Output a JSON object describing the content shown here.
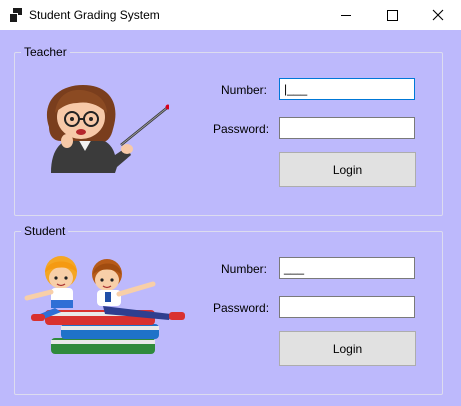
{
  "window": {
    "title": "Student Grading System",
    "icons": {
      "app": "app-icon",
      "minimize": "minimize-icon",
      "maximize": "maximize-icon",
      "close": "close-icon"
    }
  },
  "teacher": {
    "legend": "Teacher",
    "number_label": "Number:",
    "number_value": "|___",
    "password_label": "Password:",
    "password_value": "",
    "login_label": "Login",
    "image": "teacher-illustration"
  },
  "student": {
    "legend": "Student",
    "number_label": "Number:",
    "number_value": "___",
    "password_label": "Password:",
    "password_value": "",
    "login_label": "Login",
    "image": "students-illustration"
  },
  "colors": {
    "background": "#bdb9fc",
    "focus_border": "#0078d7"
  }
}
